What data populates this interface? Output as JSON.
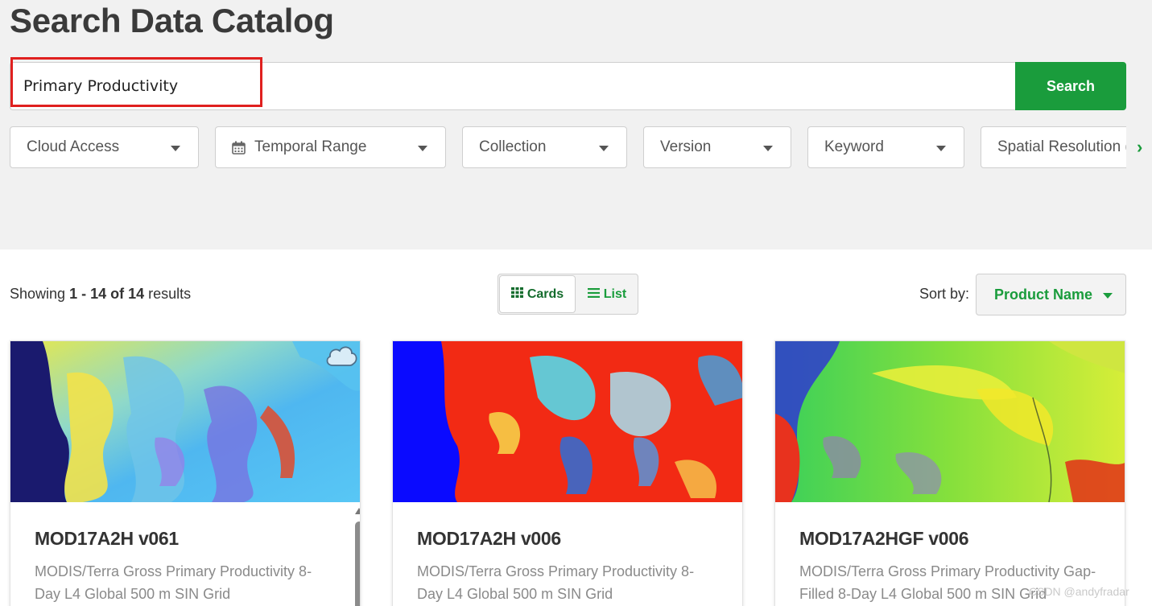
{
  "page": {
    "title": "Search Data Catalog"
  },
  "search": {
    "value": "Primary Productivity",
    "button_label": "Search"
  },
  "filters": [
    {
      "label": "Cloud Access",
      "icon": ""
    },
    {
      "label": "Temporal Range",
      "icon": "calendar-icon"
    },
    {
      "label": "Collection",
      "icon": ""
    },
    {
      "label": "Version",
      "icon": ""
    },
    {
      "label": "Keyword",
      "icon": ""
    },
    {
      "label": "Spatial Resolution (",
      "icon": ""
    }
  ],
  "results": {
    "prefix": "Showing ",
    "range": "1 - 14 of 14",
    "suffix": " results"
  },
  "view_toggle": {
    "cards_label": "Cards",
    "list_label": "List",
    "selected": "Cards"
  },
  "sort": {
    "label": "Sort by:",
    "selected": "Product Name"
  },
  "cards": [
    {
      "title": "MOD17A2H v061",
      "description": "MODIS/Terra Gross Primary Productivity 8-Day L4 Global 500 m SIN Grid",
      "cloud_badge": true
    },
    {
      "title": "MOD17A2H v006",
      "description": "MODIS/Terra Gross Primary Productivity 8-Day L4 Global 500 m SIN Grid",
      "cloud_badge": false
    },
    {
      "title": "MOD17A2HGF v006",
      "description": "MODIS/Terra Gross Primary Productivity Gap-Filled 8-Day L4 Global 500 m SIN Grid",
      "cloud_badge": false
    }
  ],
  "watermark": "CSDN @andyfradar",
  "colors": {
    "accent": "#1a9c3c",
    "highlight": "#e0201f",
    "band": "#f1f1f1"
  }
}
